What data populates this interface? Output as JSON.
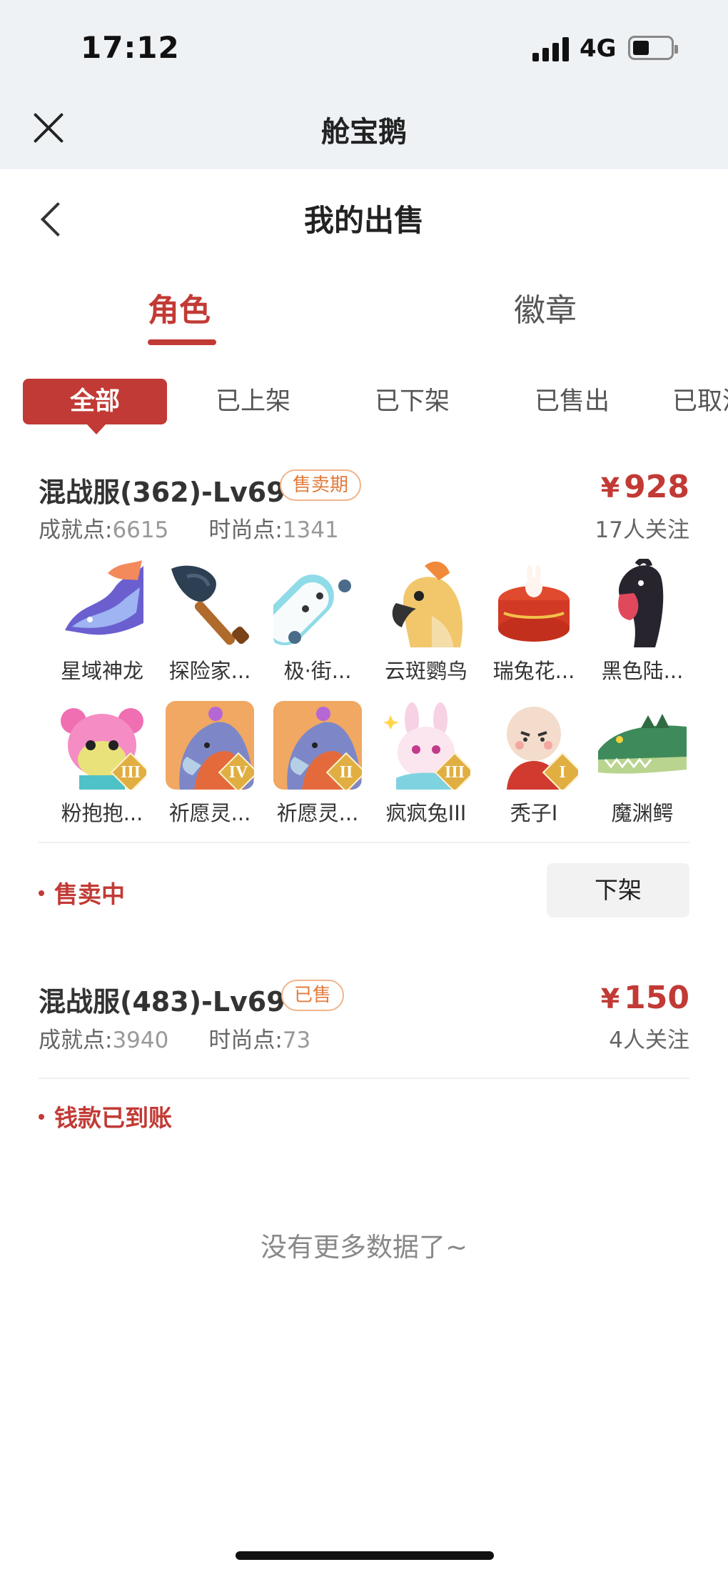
{
  "status_bar": {
    "time": "17:12",
    "network": "4G"
  },
  "app": {
    "title": "舱宝鹅"
  },
  "page": {
    "title": "我的出售"
  },
  "main_tabs": [
    {
      "label": "角色",
      "active": true
    },
    {
      "label": "徽章",
      "active": false
    }
  ],
  "filters": [
    {
      "label": "全部",
      "active": true
    },
    {
      "label": "已上架"
    },
    {
      "label": "已下架"
    },
    {
      "label": "已售出"
    },
    {
      "label": "已取消"
    }
  ],
  "orders": [
    {
      "title": "混战服(362)-Lv69",
      "tag": "售卖期",
      "currency": "¥",
      "price": "928",
      "achievement_label": "成就点:",
      "achievement": "6615",
      "fashion_label": "时尚点:",
      "fashion": "1341",
      "followers": "17人关注",
      "items": [
        {
          "name": "星域神龙",
          "icon": "dragon-icon"
        },
        {
          "name": "探险家...",
          "icon": "shovel-icon"
        },
        {
          "name": "极·街...",
          "icon": "skateboard-icon"
        },
        {
          "name": "云斑鹦鸟",
          "icon": "parrot-icon"
        },
        {
          "name": "瑞兔花...",
          "icon": "rabbit-cake-icon"
        },
        {
          "name": "黑色陆...",
          "icon": "black-horse-icon"
        },
        {
          "name": "粉抱抱...",
          "icon": "pink-bear-icon",
          "tier": "III"
        },
        {
          "name": "祈愿灵...",
          "icon": "wish-bird-icon",
          "tier": "IV"
        },
        {
          "name": "祈愿灵...",
          "icon": "wish-bird-icon",
          "tier": "II"
        },
        {
          "name": "疯疯兔III",
          "icon": "crazy-rabbit-icon",
          "tier": "III"
        },
        {
          "name": "秃子I",
          "icon": "bald-character-icon",
          "tier": "I"
        },
        {
          "name": "魔渊鳄",
          "icon": "crocodile-icon"
        }
      ],
      "status": "售卖中",
      "action": "下架"
    },
    {
      "title": "混战服(483)-Lv69",
      "tag": "已售",
      "currency": "¥",
      "price": "150",
      "achievement_label": "成就点:",
      "achievement": "3940",
      "fashion_label": "时尚点:",
      "fashion": "73",
      "followers": "4人关注",
      "status": "钱款已到账"
    }
  ],
  "footer": {
    "no_more": "没有更多数据了~"
  },
  "colors": {
    "accent": "#c23a35",
    "tag_orange": "#e27b3c",
    "topbar": "#eef2f5"
  }
}
